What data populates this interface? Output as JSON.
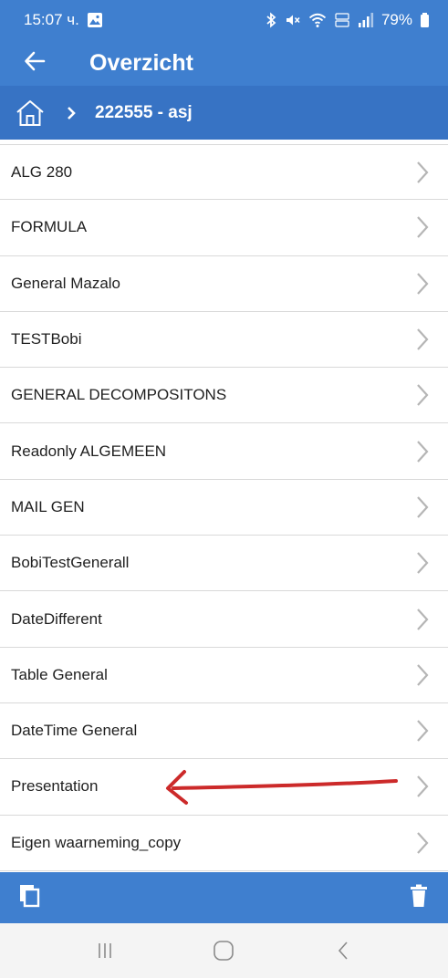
{
  "status_bar": {
    "time": "15:07 ч.",
    "battery_text": "79%"
  },
  "app_bar": {
    "title": "Overzicht"
  },
  "breadcrumb": {
    "current": "222555 - asj"
  },
  "list": {
    "items": [
      {
        "label": "ALG 280"
      },
      {
        "label": "FORMULA"
      },
      {
        "label": "General Mazalo"
      },
      {
        "label": "TESTBobi"
      },
      {
        "label": "GENERAL DECOMPOSITONS"
      },
      {
        "label": "Readonly ALGEMEEN"
      },
      {
        "label": "MAIL GEN"
      },
      {
        "label": "BobiTestGenerall"
      },
      {
        "label": "DateDifferent"
      },
      {
        "label": "Table General"
      },
      {
        "label": "DateTime General"
      },
      {
        "label": "Presentation"
      },
      {
        "label": "Eigen waarneming_copy"
      }
    ]
  },
  "colors": {
    "primary": "#3f7fcf",
    "breadcrumb_bg": "#3773c4",
    "annotation_arrow": "#cc2a2a",
    "chevron": "#b5b5b5"
  },
  "icons": {
    "status_left": [
      "image-icon"
    ],
    "status_right": [
      "bluetooth-icon",
      "mute-icon",
      "wifi-icon",
      "volte-icon",
      "signal-icon",
      "battery-icon"
    ],
    "back": "arrow-left-icon",
    "home": "home-icon",
    "breadcrumb_separator": "chevron-right-icon",
    "list_chevron": "chevron-right-icon",
    "bottom_left": "copy-icon",
    "bottom_right": "trash-icon",
    "nav": [
      "recent-apps-icon",
      "home-nav-icon",
      "back-nav-icon"
    ]
  }
}
